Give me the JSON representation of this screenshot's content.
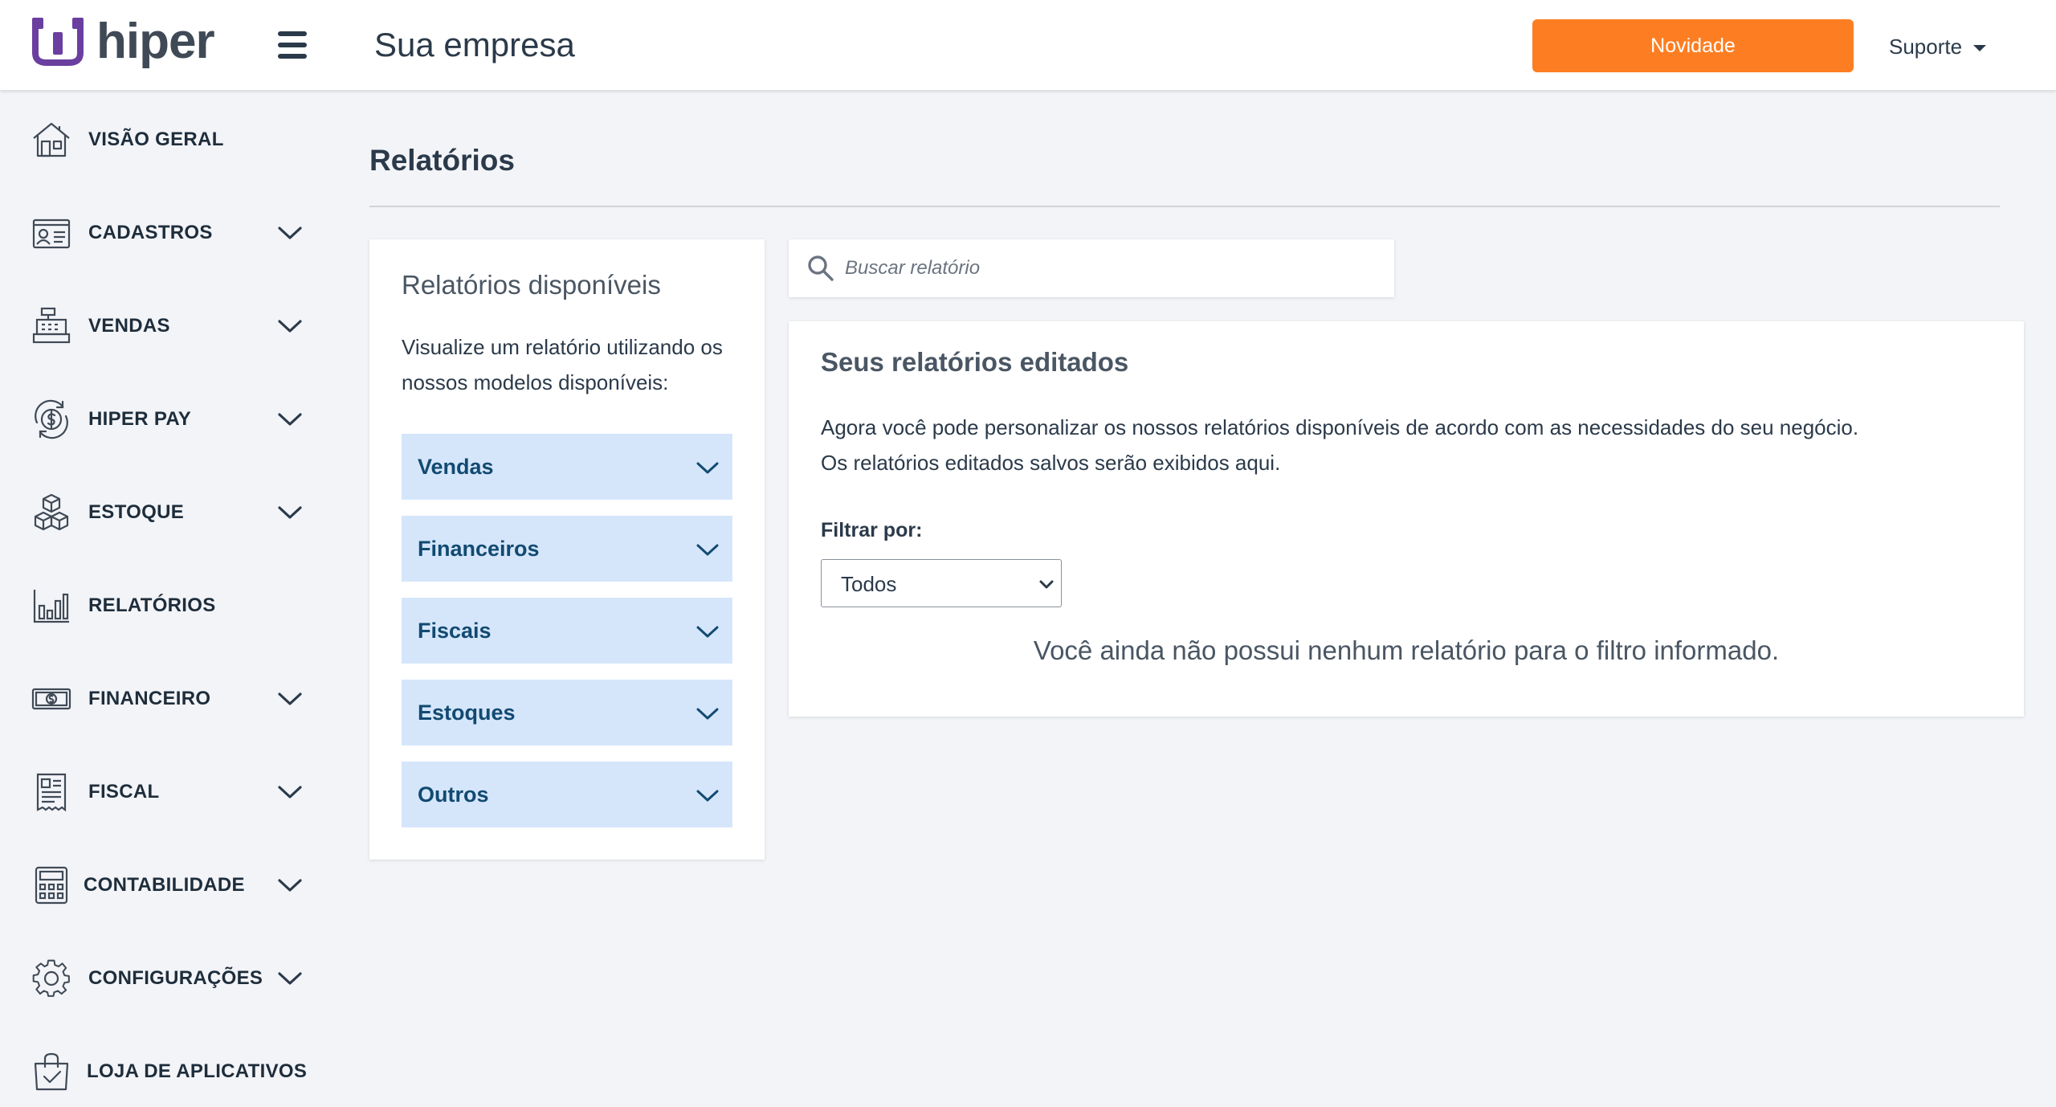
{
  "brand": {
    "name": "hiper",
    "accent": "#fd7e22",
    "logo_color": "#6b3fa0"
  },
  "header": {
    "company": "Sua empresa",
    "novidade_label": "Novidade",
    "support_label": "Suporte"
  },
  "sidebar": {
    "items": [
      {
        "label": "VISÃO GERAL",
        "icon": "home-icon",
        "expandable": false
      },
      {
        "label": "CADASTROS",
        "icon": "id-card-icon",
        "expandable": true
      },
      {
        "label": "VENDAS",
        "icon": "cash-register-icon",
        "expandable": true
      },
      {
        "label": "HIPER PAY",
        "icon": "dollar-refresh-icon",
        "expandable": true
      },
      {
        "label": "ESTOQUE",
        "icon": "boxes-icon",
        "expandable": true
      },
      {
        "label": "RELATÓRIOS",
        "icon": "bar-chart-icon",
        "expandable": false
      },
      {
        "label": "FINANCEIRO",
        "icon": "banknote-icon",
        "expandable": true
      },
      {
        "label": "FISCAL",
        "icon": "receipt-icon",
        "expandable": true
      },
      {
        "label": "CONTABILIDADE",
        "icon": "calculator-icon",
        "expandable": true
      },
      {
        "label": "CONFIGURAÇÕES",
        "icon": "gear-icon",
        "expandable": true
      },
      {
        "label": "LOJA DE APLICATIVOS",
        "icon": "shopping-bag-check-icon",
        "expandable": false
      }
    ]
  },
  "main": {
    "title": "Relatórios",
    "available": {
      "title": "Relatórios disponíveis",
      "description": "Visualize um relatório utilizando os nossos modelos disponíveis:",
      "categories": [
        "Vendas",
        "Financeiros",
        "Fiscais",
        "Estoques",
        "Outros"
      ]
    },
    "search": {
      "placeholder": "Buscar relatório"
    },
    "edited": {
      "title": "Seus relatórios editados",
      "description_line1": "Agora você pode personalizar os nossos relatórios disponíveis de acordo com as necessidades do seu negócio.",
      "description_line2": "Os relatórios editados salvos serão exibidos aqui.",
      "filter_label": "Filtrar por:",
      "filter_value": "Todos",
      "empty_message": "Você ainda não possui nenhum relatório para o filtro informado."
    }
  }
}
